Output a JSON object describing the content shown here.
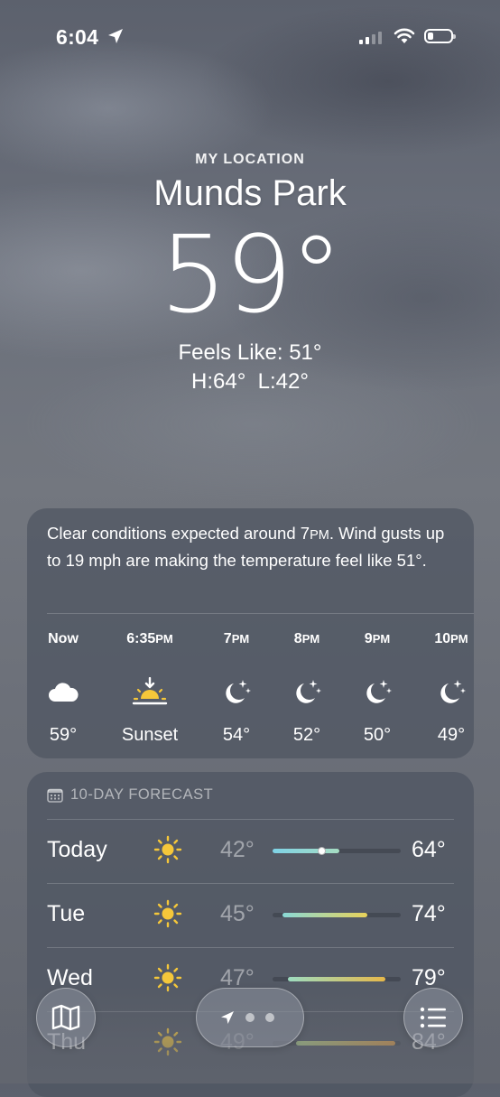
{
  "status_bar": {
    "time": "6:04"
  },
  "location": {
    "label": "MY LOCATION",
    "city": "Munds Park",
    "temperature": "59°",
    "feels_like": "Feels Like: 51°",
    "hi_lo": "H:64°  L:42°"
  },
  "summary": {
    "text_part1": "Clear conditions expected around 7",
    "pm": "PM",
    "text_part2": ". Wind gusts up to 19 mph are making the temperature feel like 51°."
  },
  "hourly": [
    {
      "label": "Now",
      "label_suffix": "",
      "icon": "cloud-icon",
      "temp": "59°"
    },
    {
      "label": "6:35",
      "label_suffix": "PM",
      "icon": "sunset-icon",
      "temp": "Sunset"
    },
    {
      "label": "7",
      "label_suffix": "PM",
      "icon": "moon-stars-icon",
      "temp": "54°"
    },
    {
      "label": "8",
      "label_suffix": "PM",
      "icon": "moon-stars-icon",
      "temp": "52°"
    },
    {
      "label": "9",
      "label_suffix": "PM",
      "icon": "moon-stars-icon",
      "temp": "50°"
    },
    {
      "label": "10",
      "label_suffix": "PM",
      "icon": "moon-stars-icon",
      "temp": "49°"
    }
  ],
  "forecast": {
    "header": "10-DAY FORECAST",
    "days": [
      {
        "day": "Today",
        "icon": "sun-icon",
        "low": "42°",
        "high": "64°",
        "range_start": 0.0,
        "range_end": 0.52,
        "current": 0.38,
        "colors": [
          "#7fd3e6",
          "#a6dcc2"
        ]
      },
      {
        "day": "Tue",
        "icon": "sun-icon",
        "low": "45°",
        "high": "74°",
        "range_start": 0.08,
        "range_end": 0.74,
        "colors": [
          "#8ad9d6",
          "#e8d25a"
        ]
      },
      {
        "day": "Wed",
        "icon": "sun-icon",
        "low": "47°",
        "high": "79°",
        "range_start": 0.12,
        "range_end": 0.88,
        "colors": [
          "#9ddcc0",
          "#e6b84a"
        ]
      },
      {
        "day": "Thu",
        "icon": "sun-icon",
        "low": "49°",
        "high": "84°",
        "range_start": 0.18,
        "range_end": 0.96,
        "colors": [
          "#b6d98e",
          "#e9a043"
        ]
      }
    ]
  },
  "bottom_bar": {
    "map_button": "map-icon",
    "list_button": "list-icon"
  }
}
